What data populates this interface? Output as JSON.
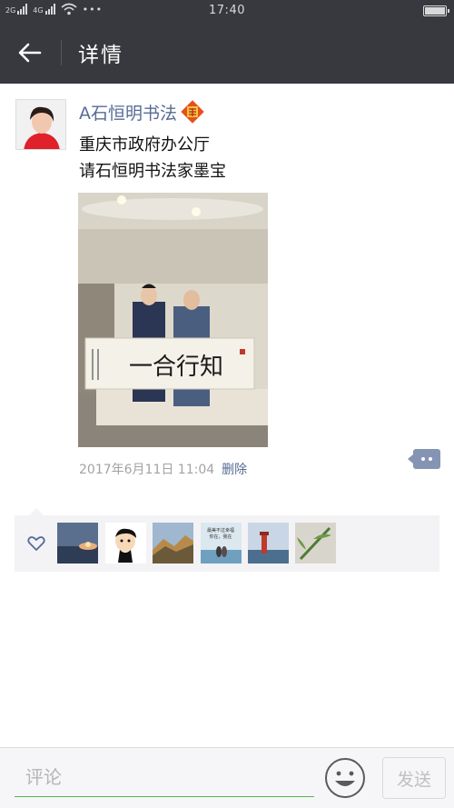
{
  "status_bar": {
    "time": "17:40",
    "net1": "2G",
    "net2": "4G",
    "dots": "•••"
  },
  "header": {
    "title": "详情"
  },
  "post": {
    "username": "A石恒明书法",
    "text_line1": "重庆市政府办公厅",
    "text_line2": "请石恒明书法家墨宝",
    "calligraphy": "一合行知",
    "timestamp": "2017年6月11日 11:04",
    "delete_label": "删除"
  },
  "likes": {
    "count_shown": 6,
    "thumb_3_caption_line1": "最美不过幸福",
    "thumb_3_caption_line2": "你在，我在"
  },
  "bottom": {
    "comment_placeholder": "评论",
    "send_label": "发送"
  },
  "colors": {
    "nav_bg": "#37393f",
    "link": "#576b95",
    "accent_green": "#52b24a",
    "action_button": "#8594b3"
  }
}
